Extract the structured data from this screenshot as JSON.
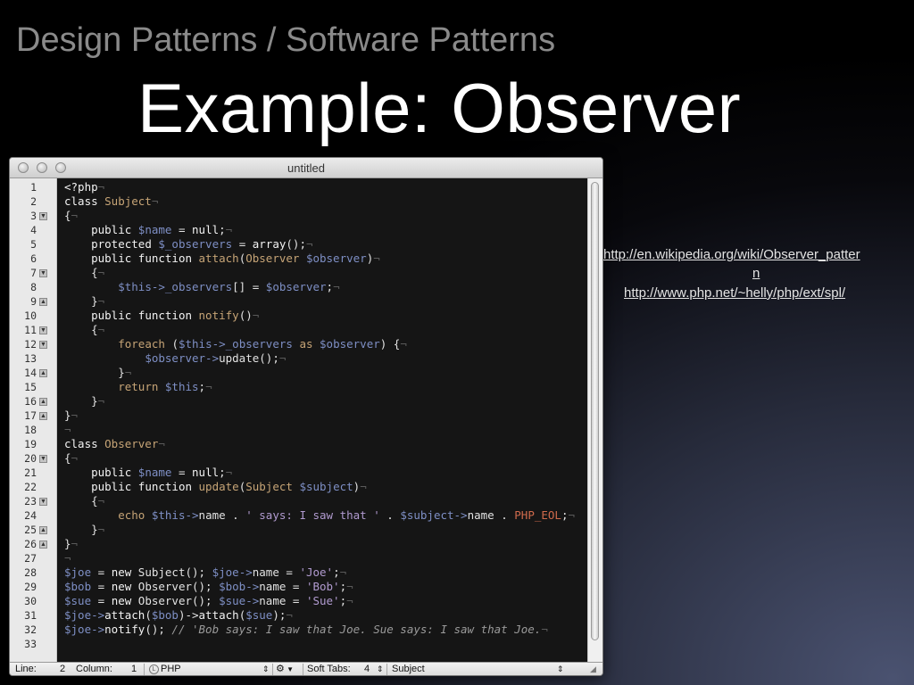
{
  "slide": {
    "supertitle": "Design Patterns / Software Patterns",
    "title": "Example: Observer"
  },
  "window": {
    "title": "untitled"
  },
  "code_lines": [
    [
      [
        "k",
        "<?php"
      ],
      [
        "i",
        "¬"
      ]
    ],
    [
      [
        "k",
        "class "
      ],
      [
        "f",
        "Subject"
      ],
      [
        "i",
        "¬"
      ]
    ],
    [
      [
        "p",
        "{"
      ],
      [
        "i",
        "¬"
      ]
    ],
    [
      [
        "p",
        "    "
      ],
      [
        "k",
        "public "
      ],
      [
        "v",
        "$name"
      ],
      [
        "p",
        " = "
      ],
      [
        "k",
        "null"
      ],
      [
        "p",
        ";"
      ],
      [
        "i",
        "¬"
      ]
    ],
    [
      [
        "p",
        "    "
      ],
      [
        "k",
        "protected "
      ],
      [
        "v",
        "$_observers"
      ],
      [
        "p",
        " = "
      ],
      [
        "k",
        "array"
      ],
      [
        "p",
        "();"
      ],
      [
        "i",
        "¬"
      ]
    ],
    [
      [
        "p",
        "    "
      ],
      [
        "k",
        "public function "
      ],
      [
        "f",
        "attach"
      ],
      [
        "p",
        "("
      ],
      [
        "f",
        "Observer "
      ],
      [
        "v",
        "$observer"
      ],
      [
        "p",
        ")"
      ],
      [
        "i",
        "¬"
      ]
    ],
    [
      [
        "p",
        "    {"
      ],
      [
        "i",
        "¬"
      ]
    ],
    [
      [
        "p",
        "        "
      ],
      [
        "v",
        "$this->_observers"
      ],
      [
        "p",
        "[] = "
      ],
      [
        "v",
        "$observer"
      ],
      [
        "p",
        ";"
      ],
      [
        "i",
        "¬"
      ]
    ],
    [
      [
        "p",
        "    }"
      ],
      [
        "i",
        "¬"
      ]
    ],
    [
      [
        "p",
        "    "
      ],
      [
        "k",
        "public function "
      ],
      [
        "f",
        "notify"
      ],
      [
        "p",
        "()"
      ],
      [
        "i",
        "¬"
      ]
    ],
    [
      [
        "p",
        "    {"
      ],
      [
        "i",
        "¬"
      ]
    ],
    [
      [
        "p",
        "        "
      ],
      [
        "f",
        "foreach "
      ],
      [
        "p",
        "("
      ],
      [
        "v",
        "$this->_observers"
      ],
      [
        "p",
        " "
      ],
      [
        "f",
        "as "
      ],
      [
        "v",
        "$observer"
      ],
      [
        "p",
        ") {"
      ],
      [
        "i",
        "¬"
      ]
    ],
    [
      [
        "p",
        "            "
      ],
      [
        "v",
        "$observer->"
      ],
      [
        "p",
        "update();"
      ],
      [
        "i",
        "¬"
      ]
    ],
    [
      [
        "p",
        "        }"
      ],
      [
        "i",
        "¬"
      ]
    ],
    [
      [
        "p",
        "        "
      ],
      [
        "f",
        "return "
      ],
      [
        "v",
        "$this"
      ],
      [
        "p",
        ";"
      ],
      [
        "i",
        "¬"
      ]
    ],
    [
      [
        "p",
        "    }"
      ],
      [
        "i",
        "¬"
      ]
    ],
    [
      [
        "p",
        "}"
      ],
      [
        "i",
        "¬"
      ]
    ],
    [
      [
        "i",
        "¬"
      ]
    ],
    [
      [
        "k",
        "class "
      ],
      [
        "f",
        "Observer"
      ],
      [
        "i",
        "¬"
      ]
    ],
    [
      [
        "p",
        "{"
      ],
      [
        "i",
        "¬"
      ]
    ],
    [
      [
        "p",
        "    "
      ],
      [
        "k",
        "public "
      ],
      [
        "v",
        "$name"
      ],
      [
        "p",
        " = "
      ],
      [
        "k",
        "null"
      ],
      [
        "p",
        ";"
      ],
      [
        "i",
        "¬"
      ]
    ],
    [
      [
        "p",
        "    "
      ],
      [
        "k",
        "public function "
      ],
      [
        "f",
        "update"
      ],
      [
        "p",
        "("
      ],
      [
        "f",
        "Subject "
      ],
      [
        "v",
        "$subject"
      ],
      [
        "p",
        ")"
      ],
      [
        "i",
        "¬"
      ]
    ],
    [
      [
        "p",
        "    {"
      ],
      [
        "i",
        "¬"
      ]
    ],
    [
      [
        "p",
        "        "
      ],
      [
        "f",
        "echo "
      ],
      [
        "v",
        "$this->"
      ],
      [
        "p",
        "name . "
      ],
      [
        "s",
        "' says: I saw that '"
      ],
      [
        "p",
        " . "
      ],
      [
        "v",
        "$subject->"
      ],
      [
        "p",
        "name . "
      ],
      [
        "n",
        "PHP_EOL"
      ],
      [
        "p",
        ";"
      ],
      [
        "i",
        "¬"
      ]
    ],
    [
      [
        "p",
        "    }"
      ],
      [
        "i",
        "¬"
      ]
    ],
    [
      [
        "p",
        "}"
      ],
      [
        "i",
        "¬"
      ]
    ],
    [
      [
        "i",
        "¬"
      ]
    ],
    [
      [
        "v",
        "$joe"
      ],
      [
        "p",
        " = "
      ],
      [
        "k",
        "new "
      ],
      [
        "p",
        "Subject(); "
      ],
      [
        "v",
        "$joe->"
      ],
      [
        "p",
        "name = "
      ],
      [
        "s",
        "'Joe'"
      ],
      [
        "p",
        ";"
      ],
      [
        "i",
        "¬"
      ]
    ],
    [
      [
        "v",
        "$bob"
      ],
      [
        "p",
        " = "
      ],
      [
        "k",
        "new "
      ],
      [
        "p",
        "Observer(); "
      ],
      [
        "v",
        "$bob->"
      ],
      [
        "p",
        "name = "
      ],
      [
        "s",
        "'Bob'"
      ],
      [
        "p",
        ";"
      ],
      [
        "i",
        "¬"
      ]
    ],
    [
      [
        "v",
        "$sue"
      ],
      [
        "p",
        " = "
      ],
      [
        "k",
        "new "
      ],
      [
        "p",
        "Observer(); "
      ],
      [
        "v",
        "$sue->"
      ],
      [
        "p",
        "name = "
      ],
      [
        "s",
        "'Sue'"
      ],
      [
        "p",
        ";"
      ],
      [
        "i",
        "¬"
      ]
    ],
    [
      [
        "v",
        "$joe->"
      ],
      [
        "k",
        "attach"
      ],
      [
        "p",
        "("
      ],
      [
        "v",
        "$bob"
      ],
      [
        "p",
        ")->"
      ],
      [
        "k",
        "attach"
      ],
      [
        "p",
        "("
      ],
      [
        "v",
        "$sue"
      ],
      [
        "p",
        ");"
      ],
      [
        "i",
        "¬"
      ]
    ],
    [
      [
        "v",
        "$joe->"
      ],
      [
        "k",
        "notify"
      ],
      [
        "p",
        "(); "
      ],
      [
        "c",
        "// 'Bob says: I saw that Joe. Sue says: I saw that Joe."
      ],
      [
        "i",
        "¬"
      ]
    ],
    [
      [
        "p",
        ""
      ]
    ]
  ],
  "line_numbers": [
    "1",
    "2",
    "3",
    "4",
    "5",
    "6",
    "7",
    "8",
    "9",
    "10",
    "11",
    "12",
    "13",
    "14",
    "15",
    "16",
    "17",
    "18",
    "19",
    "20",
    "21",
    "22",
    "23",
    "24",
    "25",
    "26",
    "27",
    "28",
    "29",
    "30",
    "31",
    "32",
    "33"
  ],
  "fold_markers": [
    {
      "line": 3,
      "dir": "open"
    },
    {
      "line": 7,
      "dir": "open"
    },
    {
      "line": 9,
      "dir": "close"
    },
    {
      "line": 11,
      "dir": "open"
    },
    {
      "line": 12,
      "dir": "open"
    },
    {
      "line": 14,
      "dir": "close"
    },
    {
      "line": 16,
      "dir": "close"
    },
    {
      "line": 17,
      "dir": "close"
    },
    {
      "line": 20,
      "dir": "open"
    },
    {
      "line": 23,
      "dir": "open"
    },
    {
      "line": 25,
      "dir": "close"
    },
    {
      "line": 26,
      "dir": "close"
    }
  ],
  "statusbar": {
    "line_label": "Line:",
    "line_value": "2",
    "column_label": "Column:",
    "column_value": "1",
    "language": "PHP",
    "tabs_label": "Soft Tabs:",
    "tabs_value": "4",
    "symbol": "Subject"
  },
  "links": [
    "http://en.wikipedia.org/wiki/Observer_patter",
    "n",
    "http://www.php.net/~helly/php/ext/spl/"
  ],
  "colors": {
    "keyword": "#f3f3f3",
    "variable": "#7e8fc5",
    "function": "#c6a476",
    "string": "#b19bd0",
    "constant": "#cf6a4c",
    "comment": "#9a9a9a",
    "editor_background": "#151515"
  }
}
